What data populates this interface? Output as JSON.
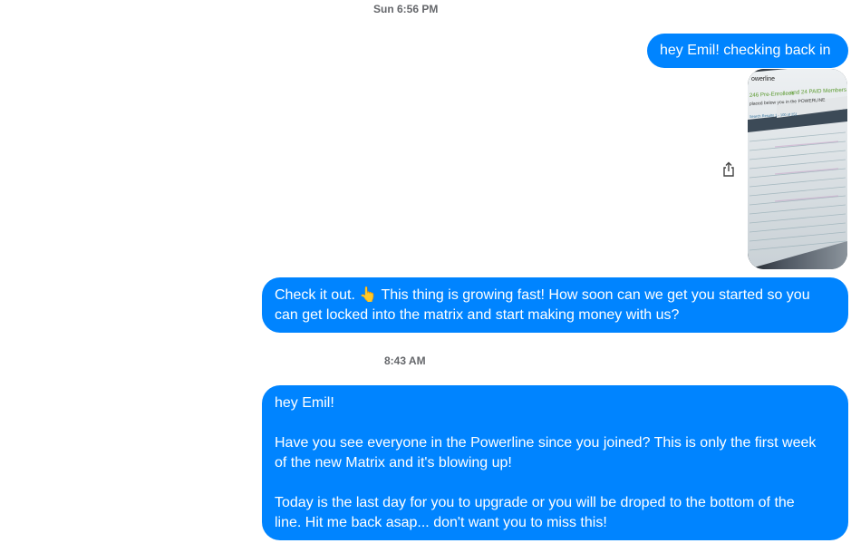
{
  "conversation": {
    "timestamps": [
      "Sun 6:56 PM",
      "8:43 AM"
    ],
    "messages": [
      {
        "lines": [
          "hey Emil!  checking back in"
        ]
      },
      {
        "type": "image"
      },
      {
        "lines": [
          "Check it out. 👆 This thing is growing fast! How soon can we get you started so you",
          "can get locked into the matrix and start making money with us?"
        ]
      },
      {
        "lines": [
          "hey Emil!",
          "",
          "Have you see everyone in the Powerline since you joined?  This is only the first week",
          "of the new Matrix and it's blowing up!",
          "",
          "Today is the last day for you to upgrade or you will be droped to the bottom of the",
          "line.  Hit me back asap... don't want you to miss this!"
        ]
      }
    ],
    "image_text": {
      "brand": "owerline",
      "headline_a": "246 Pre-Enrollees",
      "headline_b": "and 24 PAID Members",
      "subhead": "placed below you in the POWERLINE",
      "results": "Search Results 1 - 100 of 251"
    },
    "colors": {
      "sent_bubble": "#0084ff",
      "timestamp": "#65676b"
    },
    "icons": {
      "share": "share-icon"
    }
  }
}
